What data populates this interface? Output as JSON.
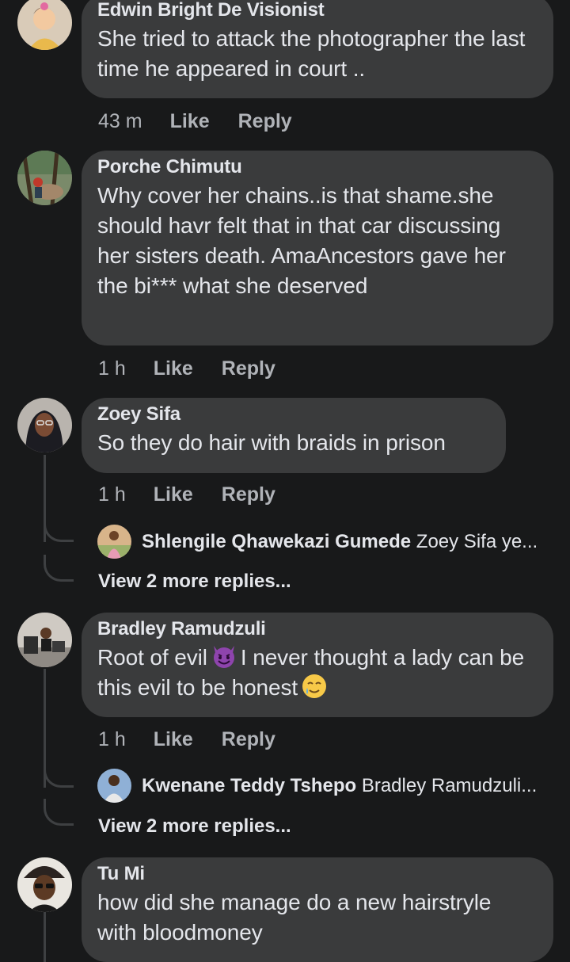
{
  "comments": [
    {
      "author": "Edwin Bright De Visionist",
      "text": "She tried to attack the photographer the last time he appeared in court ..",
      "time": "43 m",
      "like": "Like",
      "reply": "Reply"
    },
    {
      "author": "Porche Chimutu",
      "text": "Why cover her chains..is that shame.she should havr felt that in that car discussing her sisters death. AmaAncestors gave her the bi*** what she deserved",
      "time": "1 h",
      "like": "Like",
      "reply": "Reply"
    },
    {
      "author": "Zoey Sifa",
      "text": "So they do hair with braids in prison",
      "time": "1 h",
      "like": "Like",
      "reply": "Reply",
      "reply_preview": {
        "name": "Shlengile Qhawekazi Gumede",
        "text": "Zoey Sifa ye..."
      },
      "view_more": "View 2 more replies..."
    },
    {
      "author": "Bradley Ramudzuli",
      "text_before": "Root of evil",
      "text_middle": "I never thought a lady can be this evil to be honest",
      "time": "1 h",
      "like": "Like",
      "reply": "Reply",
      "reply_preview": {
        "name": "Kwenane Teddy Tshepo",
        "text": "Bradley Ramudzuli..."
      },
      "view_more": "View 2 more replies..."
    },
    {
      "author": "Tu Mi",
      "text": "how did she manage do a new hairstryle with bloodmoney"
    }
  ],
  "emojis": [
    "smiling-devil-emoji",
    "tear-smile-emoji"
  ]
}
